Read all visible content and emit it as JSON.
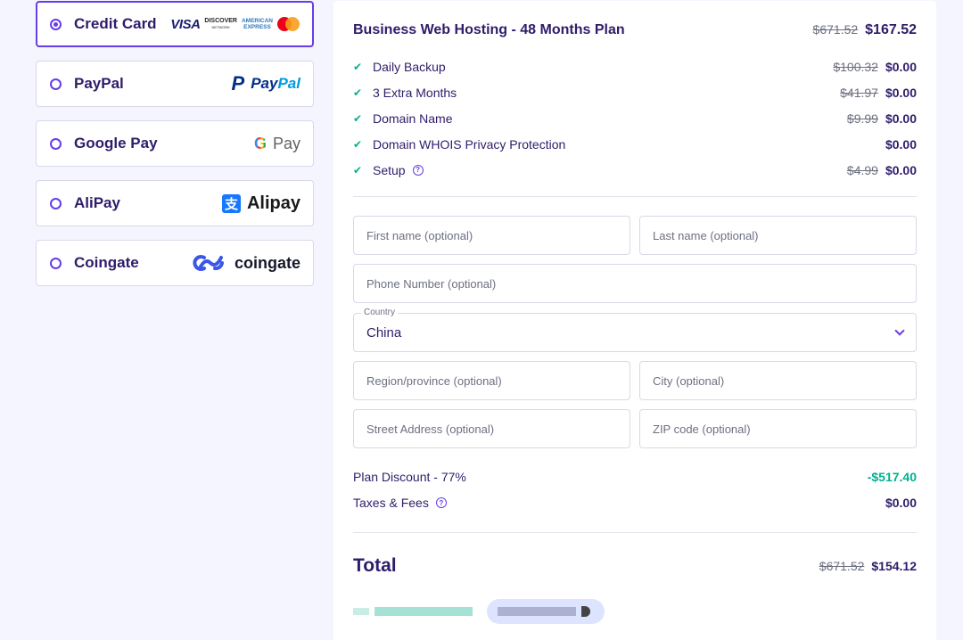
{
  "payment_methods": [
    {
      "label": "Credit Card",
      "selected": true
    },
    {
      "label": "PayPal",
      "selected": false
    },
    {
      "label": "Google Pay",
      "selected": false
    },
    {
      "label": "AliPay",
      "selected": false
    },
    {
      "label": "Coingate",
      "selected": false
    }
  ],
  "logos": {
    "visa": "VISA",
    "discover": "DISCOVER",
    "discover_sub": "NETWORK",
    "amex_line1": "AMERICAN",
    "amex_line2": "EXPRESS",
    "paypal_mark": "P",
    "paypal_1": "Pay",
    "paypal_2": "Pal",
    "gpay_g": "G",
    "gpay_word": "Pay",
    "alipay_icon": "支",
    "alipay_word": "Alipay",
    "coingate_word": "coingate"
  },
  "plan": {
    "title": "Business Web Hosting - 48 Months Plan",
    "old_price": "$671.52",
    "price": "$167.52"
  },
  "features": [
    {
      "name": "Daily Backup",
      "old_price": "$100.32",
      "price": "$0.00"
    },
    {
      "name": "3 Extra Months",
      "old_price": "$41.97",
      "price": "$0.00"
    },
    {
      "name": "Domain Name",
      "old_price": "$9.99",
      "price": "$0.00"
    },
    {
      "name": "Domain WHOIS Privacy Protection",
      "old_price": "",
      "price": "$0.00"
    },
    {
      "name": "Setup",
      "old_price": "$4.99",
      "price": "$0.00",
      "help": "?"
    }
  ],
  "form": {
    "first_name": "First name (optional)",
    "last_name": "Last name (optional)",
    "phone": "Phone Number (optional)",
    "country_label": "Country",
    "country_value": "China",
    "region": "Region/province (optional)",
    "city": "City (optional)",
    "street": "Street Address (optional)",
    "zip": "ZIP code (optional)"
  },
  "summary": {
    "discount_label": "Plan Discount - 77%",
    "discount_value": "-$517.40",
    "taxes_label": "Taxes & Fees",
    "taxes_help": "?",
    "taxes_value": "$0.00"
  },
  "total": {
    "label": "Total",
    "old_price": "$671.52",
    "price": "$154.12"
  },
  "colors": {
    "accent": "#673de6",
    "success": "#00b090",
    "text": "#2f1c6a",
    "background": "#f4f5ff"
  }
}
